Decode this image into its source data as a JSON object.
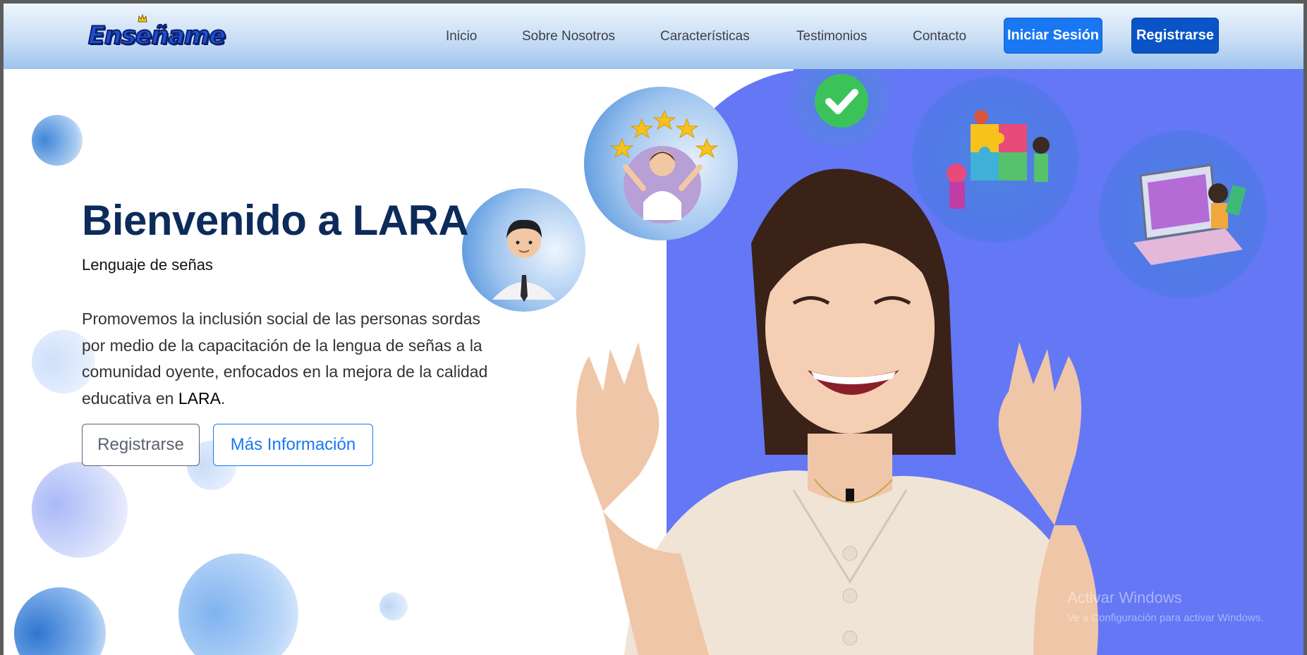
{
  "brand": {
    "logo_text": "Enseñame"
  },
  "nav": {
    "links": [
      "Inicio",
      "Sobre Nosotros",
      "Características",
      "Testimonios",
      "Contacto"
    ],
    "login_label": "Iniciar Sesión",
    "register_label": "Registrarse"
  },
  "hero": {
    "title": "Bienvenido a LARA",
    "subtitle": "Lenguaje de señas",
    "description_pre": "Promovemos la inclusión social de las personas sordas por medio de la capacitación de la lengua de señas a la comunidad oyente, enfocados en la mejora de la calidad educativa en ",
    "description_brand": "LARA",
    "description_post": ".",
    "register_label": "Registrarse",
    "info_label": "Más Información"
  },
  "os_watermark": {
    "title": "Activar Windows",
    "subtitle": "Ve a Configuración para activar Windows."
  },
  "colors": {
    "accent_blue": "#1977f2",
    "dark_blue_button": "#0a54c8",
    "hero_title": "#0c2b5a",
    "panel_blue": "#6477f5"
  }
}
